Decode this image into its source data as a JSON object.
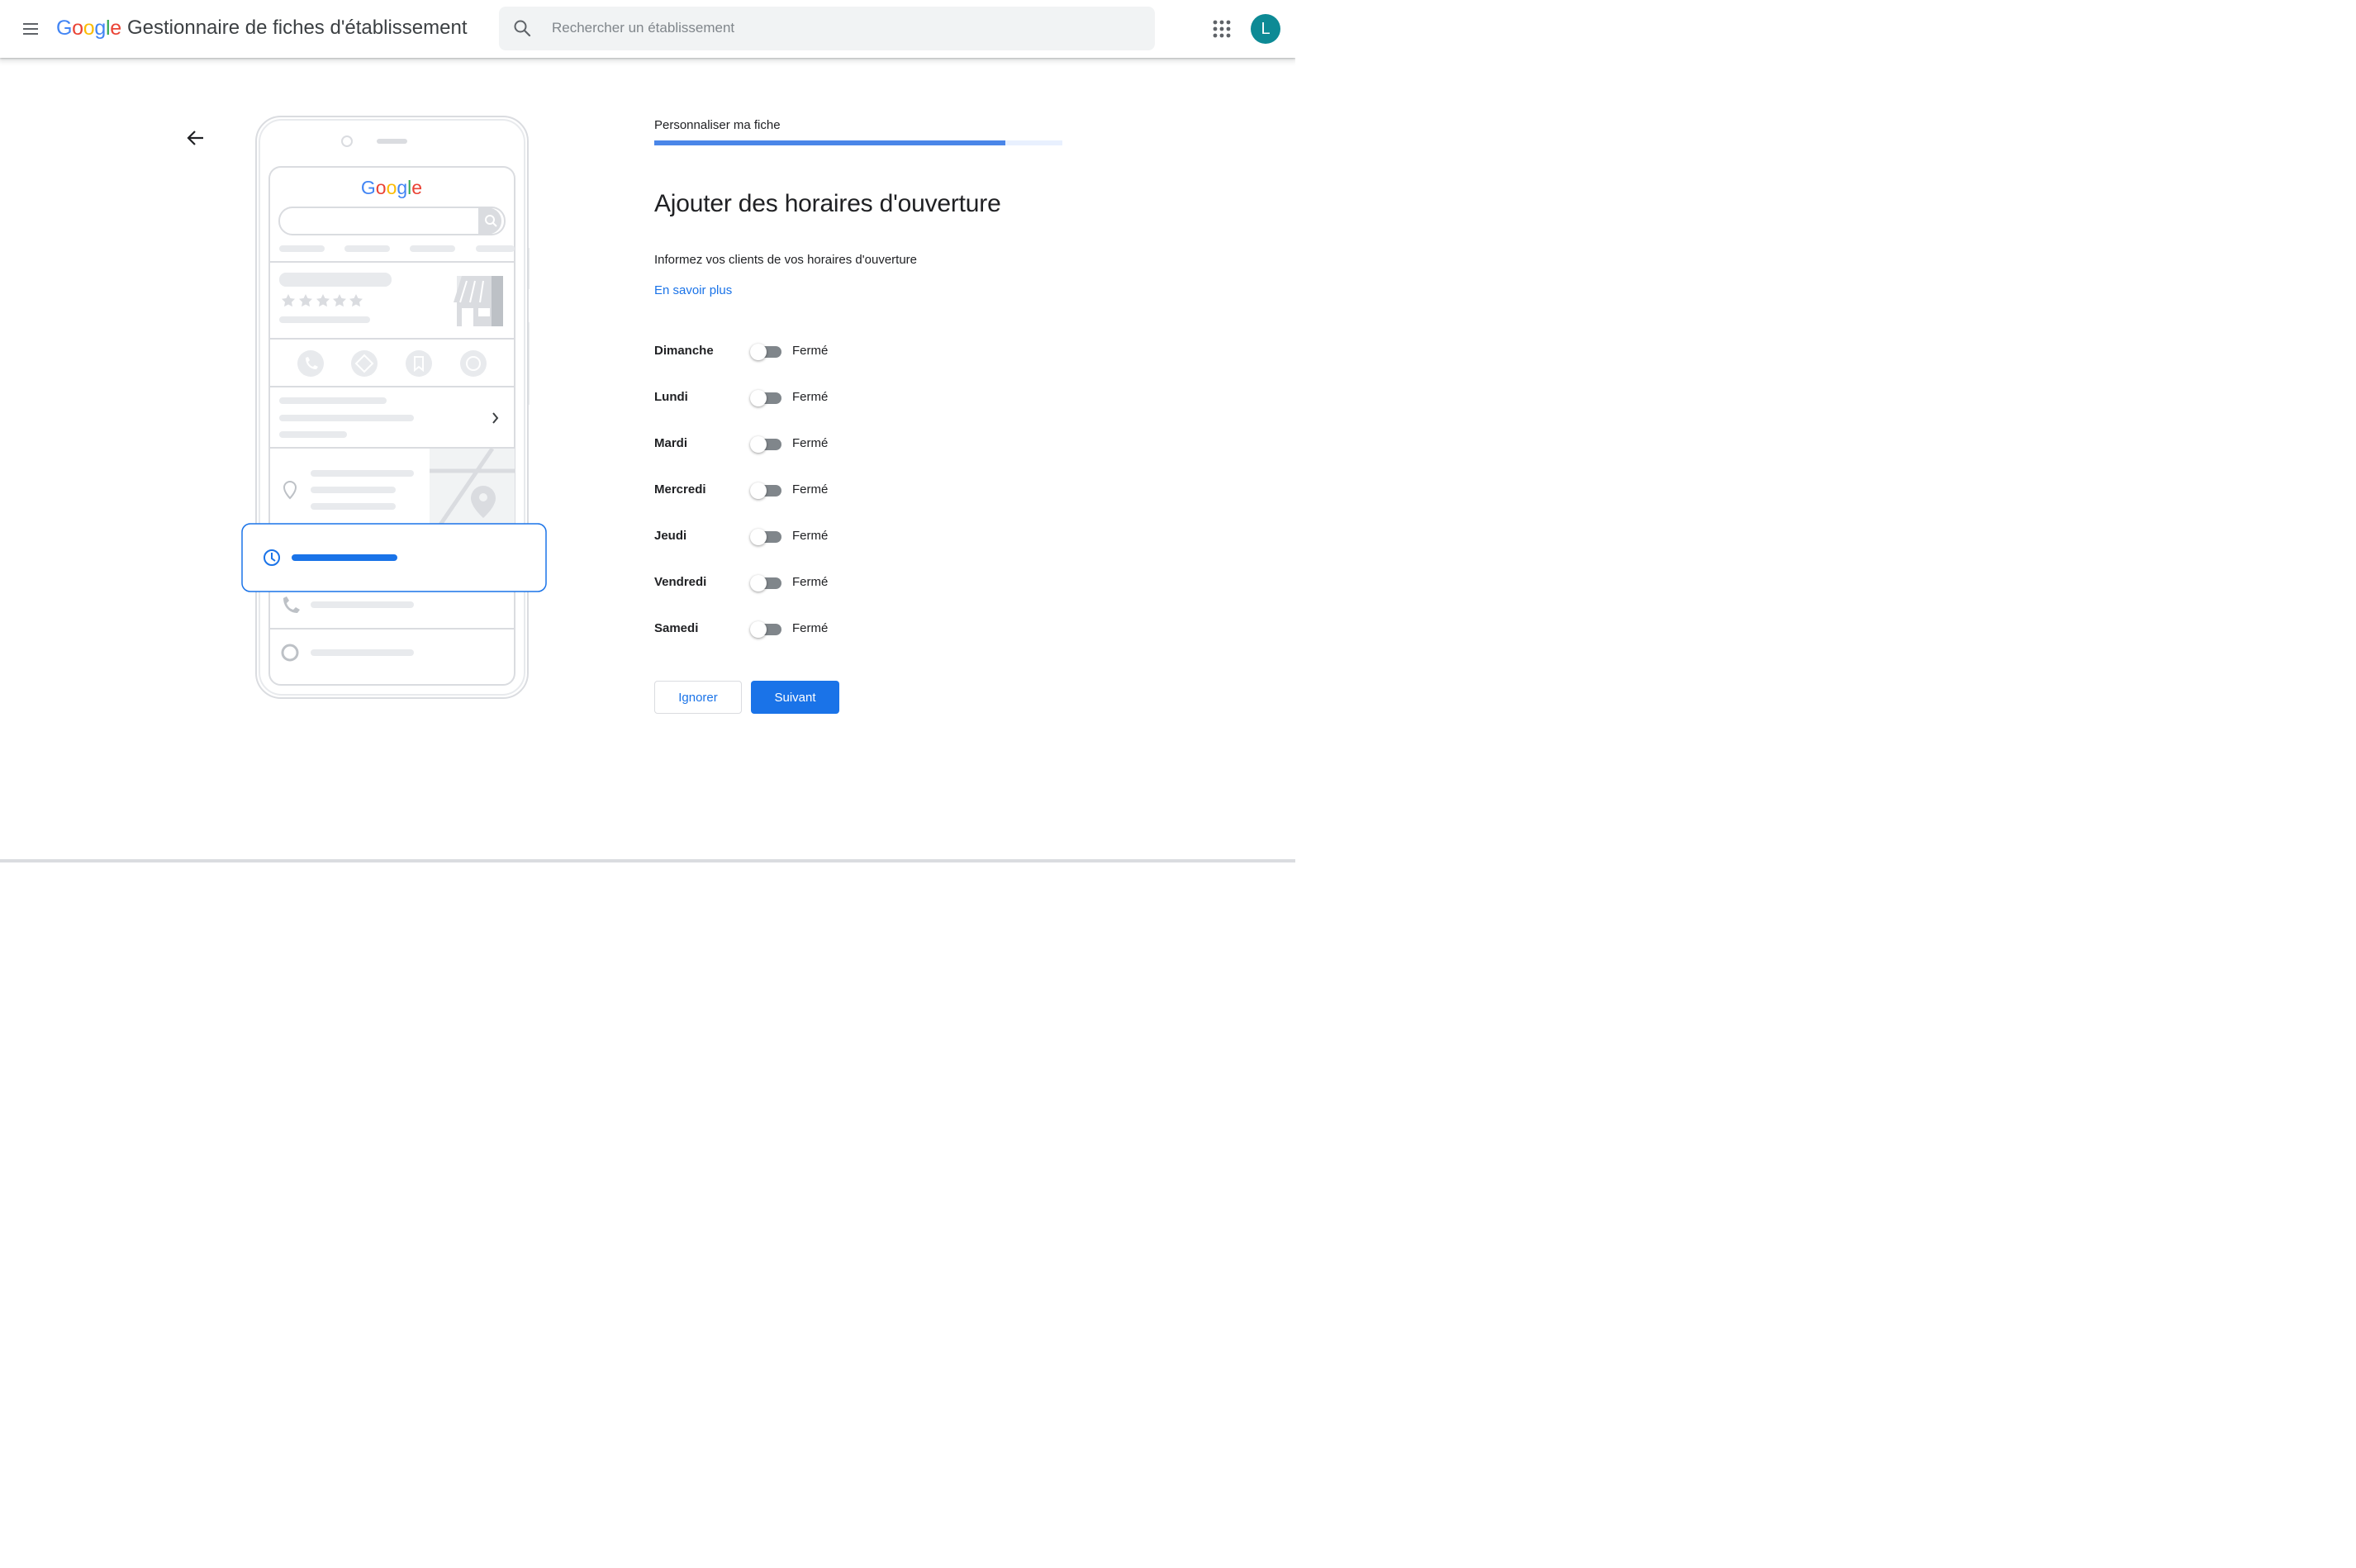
{
  "header": {
    "logo_text": "Google",
    "app_title": "Gestionnaire de fiches d'établissement",
    "search_placeholder": "Rechercher un établissement",
    "avatar_initial": "L"
  },
  "illustration": {
    "phone_logo": "Google"
  },
  "main": {
    "step_label": "Personnaliser ma fiche",
    "progress": 0.86,
    "title": "Ajouter des horaires d'ouverture",
    "subtitle": "Informez vos clients de vos horaires d'ouverture",
    "learn_more": "En savoir plus",
    "days": [
      {
        "name": "Dimanche",
        "state": "Fermé",
        "open": false
      },
      {
        "name": "Lundi",
        "state": "Fermé",
        "open": false
      },
      {
        "name": "Mardi",
        "state": "Fermé",
        "open": false
      },
      {
        "name": "Mercredi",
        "state": "Fermé",
        "open": false
      },
      {
        "name": "Jeudi",
        "state": "Fermé",
        "open": false
      },
      {
        "name": "Vendredi",
        "state": "Fermé",
        "open": false
      },
      {
        "name": "Samedi",
        "state": "Fermé",
        "open": false
      }
    ],
    "ignore_button": "Ignorer",
    "next_button": "Suivant"
  },
  "colors": {
    "accent": "#1a73e8",
    "progress": "#4a86e8",
    "avatar": "#0d8a95"
  }
}
